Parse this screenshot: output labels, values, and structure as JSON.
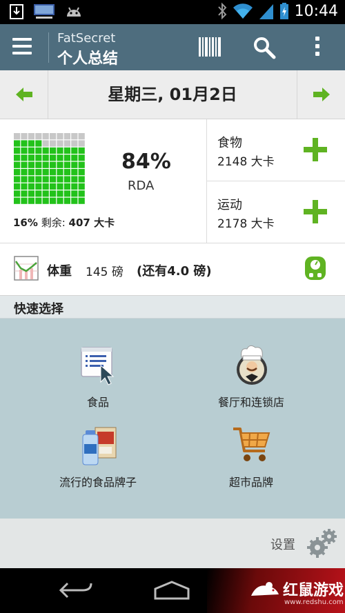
{
  "status_bar": {
    "time": "10:44"
  },
  "app": {
    "name": "FatSecret",
    "page_title": "个人总结"
  },
  "date_nav": {
    "date": "星期三, 01月2日"
  },
  "rda": {
    "percent": "84%",
    "label": "RDA",
    "consumed_fraction": 0.84,
    "remaining_percent": "16%",
    "remaining_label": "剩余:",
    "remaining_value": "407 大卡"
  },
  "food": {
    "title": "食物",
    "value": "2148 大卡"
  },
  "exercise": {
    "title": "运动",
    "value": "2178 大卡"
  },
  "weight": {
    "label": "体重",
    "value": "145 磅",
    "goal": "(还有4.0 磅)"
  },
  "quick_select": {
    "title": "快速选择",
    "items": [
      {
        "label": "食品",
        "icon": "food-list-icon"
      },
      {
        "label": "餐厅和连锁店",
        "icon": "chef-icon"
      },
      {
        "label": "流行的食品牌子",
        "icon": "grocery-brands-icon"
      },
      {
        "label": "超市品牌",
        "icon": "shopping-cart-icon"
      }
    ]
  },
  "settings": {
    "label": "设置"
  },
  "watermark": {
    "brand": "红鼠游戏",
    "url": "www.redshu.com"
  },
  "colors": {
    "action_bar": "#4e6d7e",
    "accent_green": "#5fb322",
    "grid_filled": "#22c21a",
    "quick_panel": "#b8cdd2"
  }
}
